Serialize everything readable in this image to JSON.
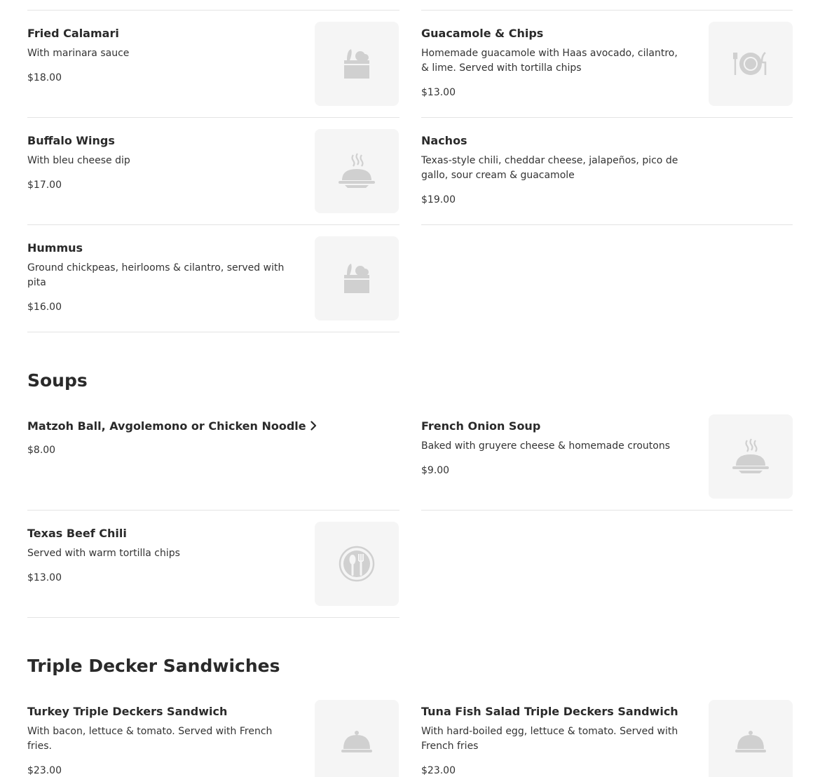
{
  "sections": {
    "appetizers": {
      "items": [
        {
          "name": "Fried Calamari",
          "description": "With marinara sauce",
          "price": "$18.00",
          "icon": "grocery-bag-icon"
        },
        {
          "name": "Guacamole & Chips",
          "description": "Homemade guacamole with Haas avocado, cilantro, & lime. Served with tortilla chips",
          "price": "$13.00",
          "icon": "plate-utensils-icon"
        },
        {
          "name": "Buffalo Wings",
          "description": "With bleu cheese dip",
          "price": "$17.00",
          "icon": "steaming-dish-icon"
        },
        {
          "name": "Nachos",
          "description": "Texas-style chili, cheddar cheese, jalapeños, pico de gallo, sour cream & guacamole",
          "price": "$19.00"
        },
        {
          "name": "Hummus",
          "description": "Ground chickpeas, heirlooms & cilantro, served with pita",
          "price": "$16.00",
          "icon": "grocery-bag-icon"
        }
      ]
    },
    "soups": {
      "title": "Soups",
      "items": [
        {
          "name": "Matzoh Ball, Avgolemono or Chicken Noodle",
          "price": "$8.00",
          "icon": "chevron-right-icon"
        },
        {
          "name": "French Onion Soup",
          "description": "Baked with gruyere cheese & homemade croutons",
          "price": "$9.00",
          "icon": "steaming-dish-icon"
        },
        {
          "name": "Texas Beef Chili",
          "description": "Served with warm tortilla chips",
          "price": "$13.00",
          "icon": "spoon-fork-circle-icon"
        }
      ]
    },
    "sandwiches": {
      "title": "Triple Decker Sandwiches",
      "items": [
        {
          "name": "Turkey Triple Deckers Sandwich",
          "description": "With bacon, lettuce & tomato. Served with French fries.",
          "price": "$23.00",
          "icon": "cloche-icon"
        },
        {
          "name": "Tuna Fish Salad Triple Deckers Sandwich",
          "description": "With hard-boiled egg, lettuce & tomato. Served with French fries",
          "price": "$23.00",
          "icon": "cloche-icon"
        }
      ]
    }
  },
  "colors": {
    "text": "#2a2a2a",
    "divider": "#e3e3e3",
    "thumb_bg": "#f5f5f5",
    "icon": "#cfcfcf"
  }
}
